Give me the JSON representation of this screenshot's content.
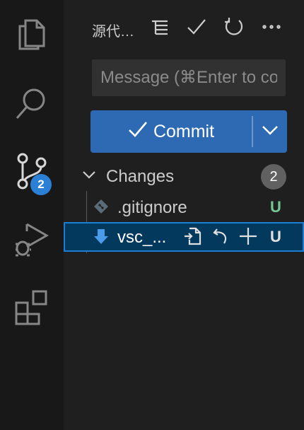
{
  "activity_bar": {
    "items": [
      {
        "name": "explorer",
        "icon": "files-icon"
      },
      {
        "name": "search",
        "icon": "search-icon"
      },
      {
        "name": "source-control",
        "icon": "source-control-icon",
        "badge": "2"
      },
      {
        "name": "run-and-debug",
        "icon": "run-debug-icon"
      },
      {
        "name": "extensions",
        "icon": "extensions-icon"
      }
    ]
  },
  "header": {
    "title": "源代码管理",
    "actions": [
      "view-as-tree-icon",
      "commit-check-icon",
      "refresh-icon",
      "more-actions-icon"
    ]
  },
  "commit": {
    "message_placeholder": "Message (⌘Enter to commit on \"main\")",
    "message_value": "",
    "button_label": "Commit"
  },
  "changes": {
    "label": "Changes",
    "count": "2",
    "files": [
      {
        "name": ".gitignore",
        "status": "U",
        "status_color": "#73c991",
        "icon": "git-file-icon"
      },
      {
        "name": "vsc_...",
        "status": "U",
        "status_color": "#e0e0e0",
        "icon": "download-file-icon",
        "selected": true
      }
    ]
  },
  "colors": {
    "accent": "#2d6ab3",
    "badge": "#2b7fd4",
    "selection": "#04395e",
    "untracked": "#73c991"
  }
}
